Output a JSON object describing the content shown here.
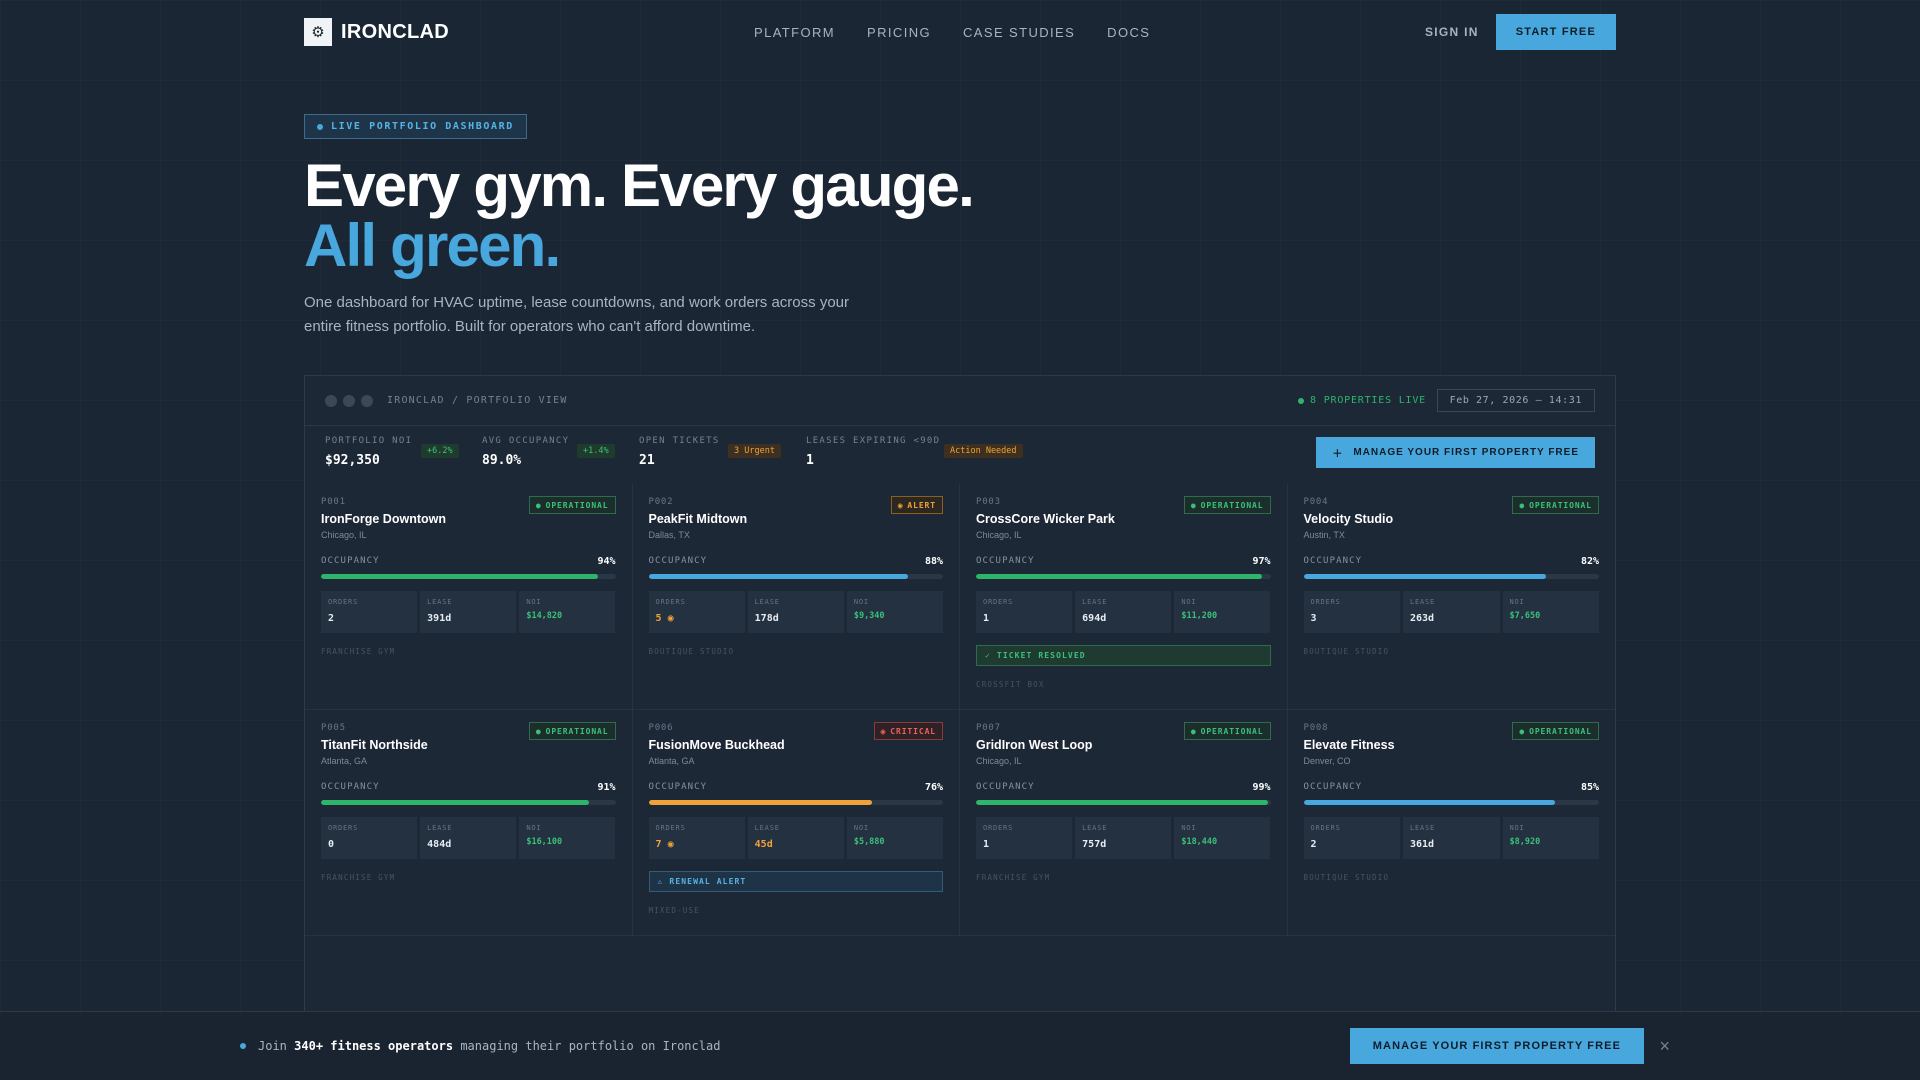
{
  "nav": {
    "brand": "IRONCLAD",
    "logo_icon": "gear-icon",
    "links": [
      "PLATFORM",
      "PRICING",
      "CASE STUDIES",
      "DOCS"
    ],
    "sign_in": "SIGN IN",
    "cta": "START FREE"
  },
  "hero": {
    "badge": "LIVE PORTFOLIO DASHBOARD",
    "title_line1": "Every gym. Every gauge.",
    "title_line2": "All green.",
    "subtitle": "One dashboard for HVAC uptime, lease countdowns, and work orders across your entire fitness portfolio. Built for operators who can't afford downtime."
  },
  "panel": {
    "path": "IRONCLAD / PORTFOLIO VIEW",
    "live_count": "8 PROPERTIES LIVE",
    "datetime": "Feb 27, 2026 — 14:31",
    "stats": [
      {
        "label": "PORTFOLIO NOI",
        "value": "$92,350",
        "badge": "+6.2%"
      },
      {
        "label": "AVG OCCUPANCY",
        "value": "89.0%",
        "badge": "+1.4%"
      },
      {
        "label": "OPEN TICKETS",
        "value": "21",
        "badge": "3 Urgent"
      },
      {
        "label": "LEASES EXPIRING <90D",
        "value": "1",
        "badge": "Action Needed"
      }
    ],
    "manage_button": "MANAGE YOUR FIRST PROPERTY FREE",
    "occupancy_label": "OCCUPANCY",
    "metric_labels": {
      "orders": "ORDERS",
      "lease": "LEASE",
      "noi": "NOI"
    },
    "cards": [
      {
        "id": "P001",
        "name": "IronForge Downtown",
        "location": "Chicago, IL",
        "status": "OPERATIONAL",
        "occupancy": "94%",
        "occ_fraction": 0.94,
        "orders": "2",
        "lease": "391d",
        "noi": "$14,820",
        "type": "FRANCHISE GYM"
      },
      {
        "id": "P002",
        "name": "PeakFit Midtown",
        "location": "Dallas, TX",
        "status": "ALERT",
        "occupancy": "88%",
        "occ_fraction": 0.88,
        "orders": "5",
        "lease": "178d",
        "noi": "$9,340",
        "type": "BOUTIQUE STUDIO"
      },
      {
        "id": "P003",
        "name": "CrossCore Wicker Park",
        "location": "Chicago, IL",
        "status": "OPERATIONAL",
        "occupancy": "97%",
        "occ_fraction": 0.97,
        "orders": "1",
        "lease": "694d",
        "noi": "$11,200",
        "note": "TICKET RESOLVED",
        "type": "CROSSFIT BOX"
      },
      {
        "id": "P004",
        "name": "Velocity Studio",
        "location": "Austin, TX",
        "status": "OPERATIONAL",
        "occupancy": "82%",
        "occ_fraction": 0.82,
        "orders": "3",
        "lease": "263d",
        "noi": "$7,650",
        "type": "BOUTIQUE STUDIO"
      },
      {
        "id": "P005",
        "name": "TitanFit Northside",
        "location": "Atlanta, GA",
        "status": "OPERATIONAL",
        "occupancy": "91%",
        "occ_fraction": 0.91,
        "orders": "0",
        "lease": "484d",
        "noi": "$16,100",
        "type": "FRANCHISE GYM"
      },
      {
        "id": "P006",
        "name": "FusionMove Buckhead",
        "location": "Atlanta, GA",
        "status": "CRITICAL",
        "occupancy": "76%",
        "occ_fraction": 0.76,
        "orders": "7",
        "lease": "45d",
        "noi": "$5,880",
        "note": "RENEWAL ALERT",
        "type": "MIXED-USE"
      },
      {
        "id": "P007",
        "name": "GridIron West Loop",
        "location": "Chicago, IL",
        "status": "OPERATIONAL",
        "occupancy": "99%",
        "occ_fraction": 0.99,
        "orders": "1",
        "lease": "757d",
        "noi": "$18,440",
        "type": "FRANCHISE GYM"
      },
      {
        "id": "P008",
        "name": "Elevate Fitness",
        "location": "Denver, CO",
        "status": "OPERATIONAL",
        "occupancy": "85%",
        "occ_fraction": 0.85,
        "orders": "2",
        "lease": "361d",
        "noi": "$8,920",
        "type": "BOUTIQUE STUDIO"
      }
    ]
  },
  "bottom": {
    "prefix": "Join",
    "highlight": "340+ fitness operators",
    "suffix": "managing their portfolio on Ironclad",
    "cta": "MANAGE YOUR FIRST PROPERTY FREE",
    "close_icon": "×"
  },
  "colors": {
    "accent": "#48a7dd",
    "green": "#2fb46b",
    "orange": "#f0a23a",
    "red": "#f0605a"
  }
}
